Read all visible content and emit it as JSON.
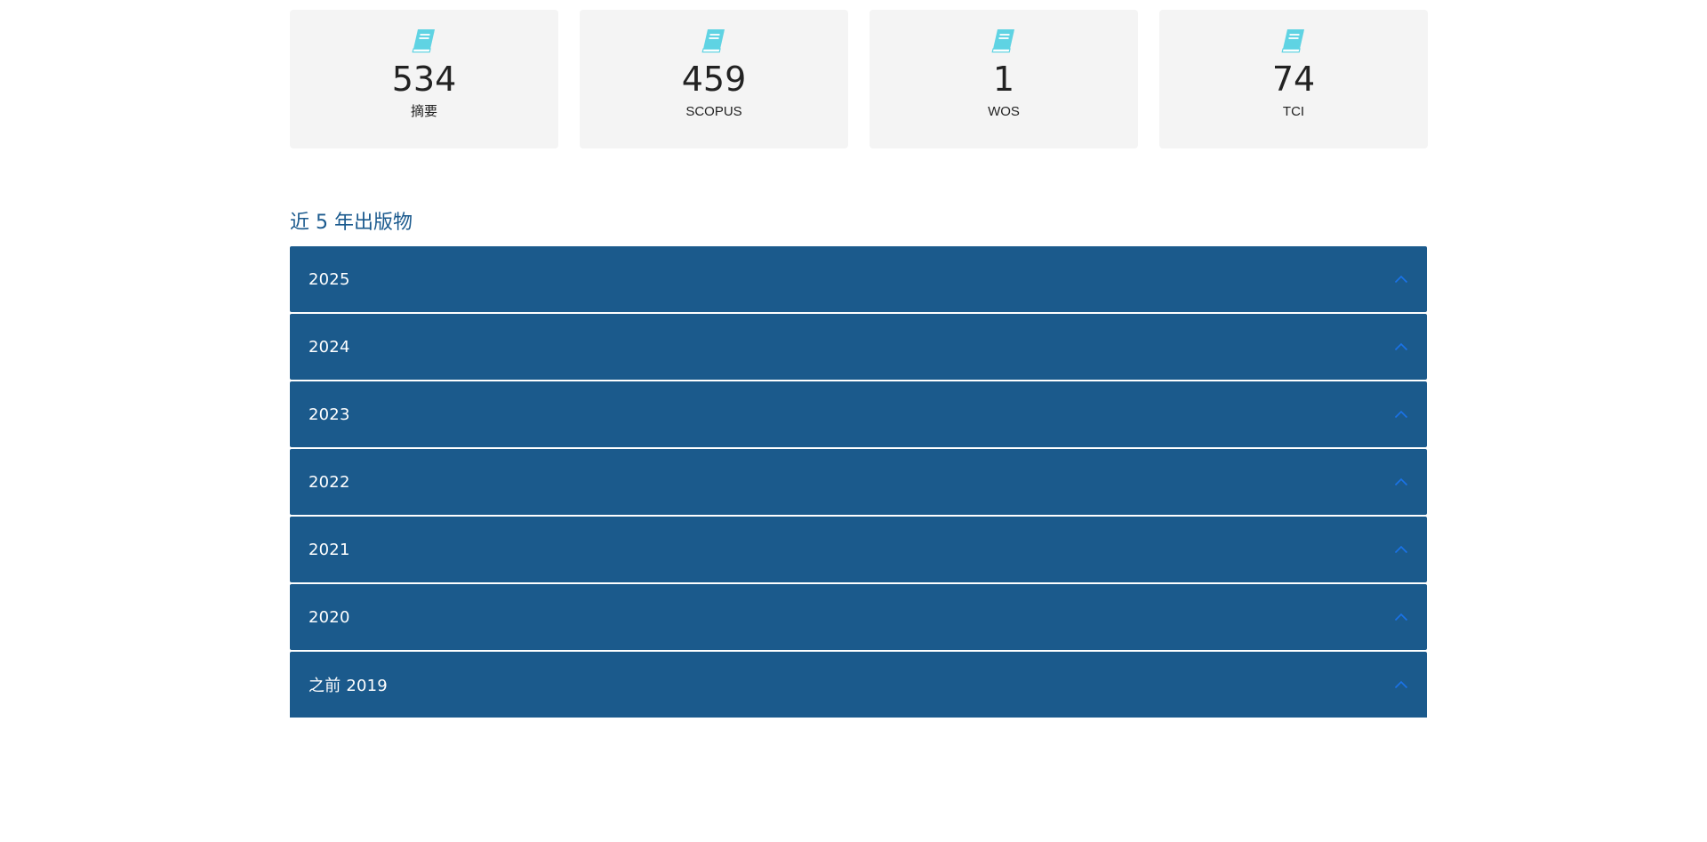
{
  "colors": {
    "card_bg": "#f4f4f4",
    "icon_cyan": "#5fd3e3",
    "title_blue": "#1b5a8e",
    "accordion_bg": "#1b5a8c",
    "chevron_blue": "#1a73e8"
  },
  "stats": [
    {
      "icon": "book-icon",
      "value": "534",
      "label": "摘要"
    },
    {
      "icon": "book-icon",
      "value": "459",
      "label": "SCOPUS"
    },
    {
      "icon": "book-icon",
      "value": "1",
      "label": "WOS"
    },
    {
      "icon": "book-icon",
      "value": "74",
      "label": "TCI"
    }
  ],
  "publications": {
    "title": "近 5 年出版物",
    "years": [
      {
        "label": "2025",
        "icon": "chevron-up-icon"
      },
      {
        "label": "2024",
        "icon": "chevron-up-icon"
      },
      {
        "label": "2023",
        "icon": "chevron-up-icon"
      },
      {
        "label": "2022",
        "icon": "chevron-up-icon"
      },
      {
        "label": "2021",
        "icon": "chevron-up-icon"
      },
      {
        "label": "2020",
        "icon": "chevron-up-icon"
      },
      {
        "label": "之前 2019",
        "icon": "chevron-up-icon"
      }
    ]
  }
}
